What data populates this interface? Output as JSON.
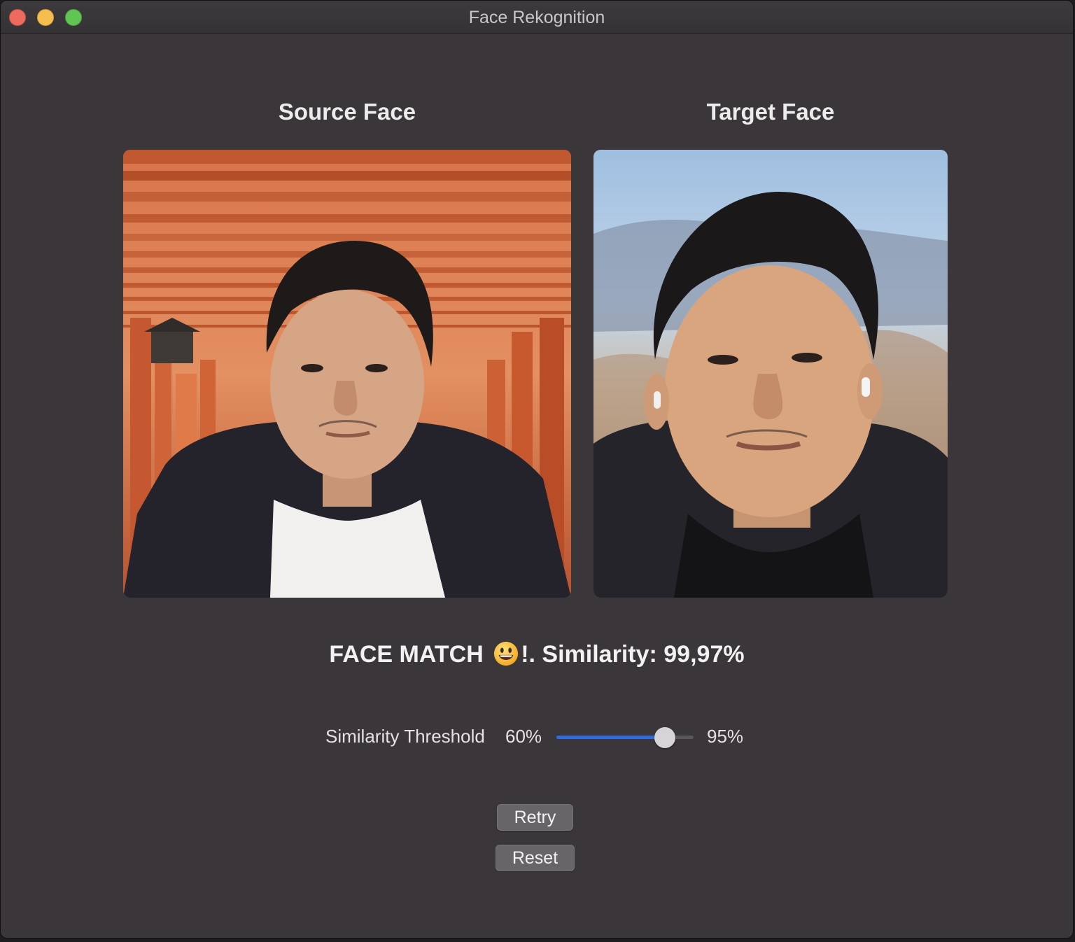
{
  "window": {
    "title": "Face Rekognition"
  },
  "panels": {
    "source": {
      "title": "Source Face"
    },
    "target": {
      "title": "Target Face"
    }
  },
  "result": {
    "prefix": "FACE MATCH",
    "emoji_icon": "grinning-face-icon",
    "suffix": "!. Similarity: 99,97%"
  },
  "threshold": {
    "label": "Similarity Threshold",
    "min_label": "60%",
    "max_label": "95%",
    "value_fraction": 0.79
  },
  "buttons": {
    "retry": "Retry",
    "reset": "Reset"
  },
  "colors": {
    "accent": "#2e6bdc",
    "background": "#3a3639"
  }
}
